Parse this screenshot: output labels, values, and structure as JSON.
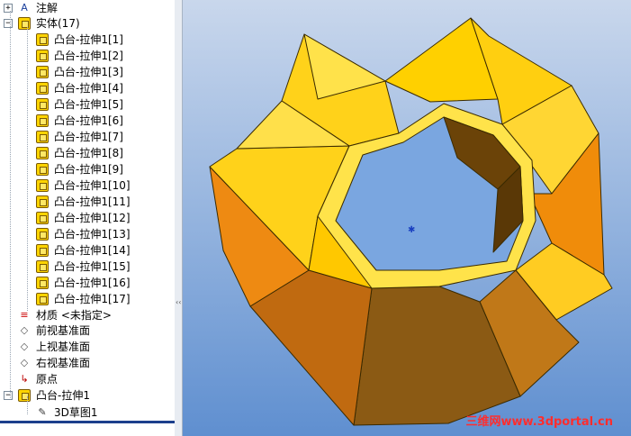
{
  "feature_tree": {
    "annotations": {
      "label": "注解",
      "expander": "+"
    },
    "solid_bodies": {
      "label": "实体(17)",
      "expander": "−",
      "items": [
        "凸台-拉伸1[1]",
        "凸台-拉伸1[2]",
        "凸台-拉伸1[3]",
        "凸台-拉伸1[4]",
        "凸台-拉伸1[5]",
        "凸台-拉伸1[6]",
        "凸台-拉伸1[7]",
        "凸台-拉伸1[8]",
        "凸台-拉伸1[9]",
        "凸台-拉伸1[10]",
        "凸台-拉伸1[11]",
        "凸台-拉伸1[12]",
        "凸台-拉伸1[13]",
        "凸台-拉伸1[14]",
        "凸台-拉伸1[15]",
        "凸台-拉伸1[16]",
        "凸台-拉伸1[17]"
      ]
    },
    "material": "材质 <未指定>",
    "front_plane": "前视基准面",
    "top_plane": "上视基准面",
    "right_plane": "右视基准面",
    "origin": "原点",
    "boss_extrude": {
      "label": "凸台-拉伸1",
      "expander": "−"
    },
    "sketch": "3D草图1"
  },
  "splitter": {
    "grip": "‹‹"
  },
  "viewport": {
    "watermark": "三维网www.3dportal.cn",
    "colors": {
      "bg_top": "#c9d7ec",
      "bg_bottom": "#5f8fd0",
      "accent": "#ffd400"
    }
  }
}
